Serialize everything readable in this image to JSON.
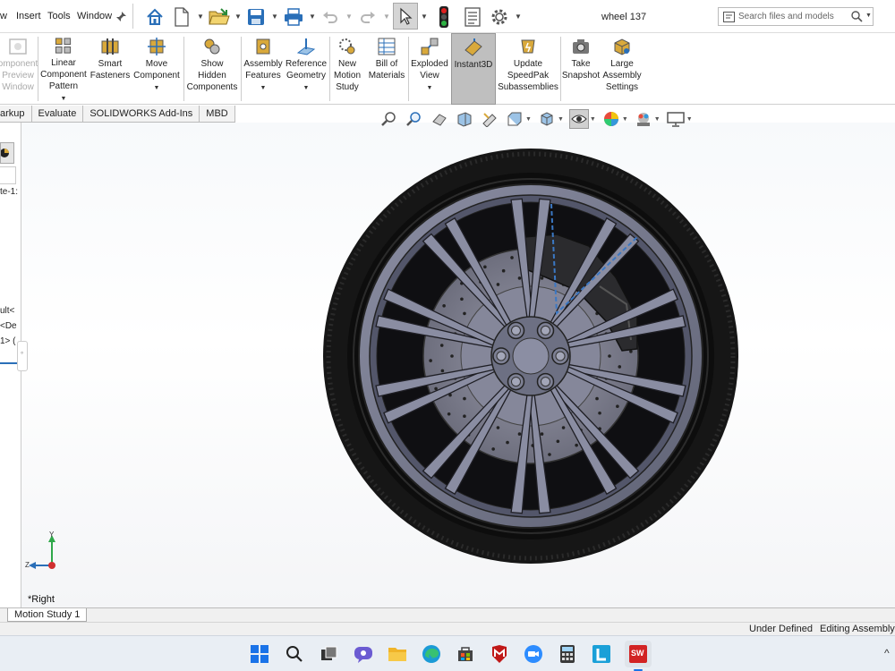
{
  "menu": {
    "items": [
      "w",
      "Insert",
      "Tools",
      "Window"
    ]
  },
  "document": {
    "title": "wheel 137"
  },
  "search": {
    "placeholder": "Search files and models"
  },
  "commands": [
    {
      "label": "omponent\nPreview\nWindow",
      "disabled": true
    },
    {
      "label": "Linear\nComponent\nPattern",
      "dropdown": true
    },
    {
      "label": "Smart\nFasteners"
    },
    {
      "label": "Move\nComponent",
      "dropdown": true
    },
    {
      "label": "Show\nHidden\nComponents"
    },
    {
      "label": "Assembly\nFeatures",
      "dropdown": true
    },
    {
      "label": "Reference\nGeometry",
      "dropdown": true
    },
    {
      "label": "New\nMotion\nStudy"
    },
    {
      "label": "Bill of\nMaterials"
    },
    {
      "label": "Exploded\nView",
      "dropdown": true
    },
    {
      "label": "Instant3D",
      "active": true
    },
    {
      "label": "Update\nSpeedPak\nSubassemblies"
    },
    {
      "label": "Take\nSnapshot"
    },
    {
      "label": "Large\nAssembly\nSettings"
    }
  ],
  "tabs": [
    "arkup",
    "Evaluate",
    "SOLIDWORKS Add-Ins",
    "MBD"
  ],
  "tree": {
    "lines": [
      "te-1:",
      "ult<",
      "<De",
      "1> ("
    ]
  },
  "triad": {
    "y": "Y",
    "z": "Z"
  },
  "view": {
    "label": "*Right"
  },
  "motion": {
    "tab": "Motion Study 1"
  },
  "status": {
    "defined": "Under Defined",
    "mode": "Editing Assembly"
  },
  "colors": {
    "accent": "#2a6fb8",
    "tire": "#161616",
    "rim": "#7c7f94",
    "active_cmd": "#bfbfbf"
  },
  "icons": {
    "toolbar": [
      "home-icon",
      "new-document-icon",
      "open-icon",
      "save-icon",
      "print-icon",
      "undo-icon",
      "redo-icon",
      "select-arrow-icon",
      "traffic-light-icon",
      "file-properties-icon",
      "options-gear-icon"
    ],
    "hud": [
      "zoom-to-fit-icon",
      "zoom-area-icon",
      "previous-view-icon",
      "section-view-icon",
      "dynamic-annotation-icon",
      "view-orientation-icon",
      "display-style-icon",
      "hide-show-icon",
      "edit-appearance-icon",
      "apply-scene-icon",
      "view-settings-icon"
    ],
    "taskbar": [
      "windows-start-icon",
      "search-icon",
      "task-view-icon",
      "chat-icon",
      "file-explorer-icon",
      "edge-icon",
      "store-icon",
      "mcafee-icon",
      "zoom-icon",
      "calculator-icon",
      "l-app-icon",
      "solidworks-icon"
    ]
  }
}
